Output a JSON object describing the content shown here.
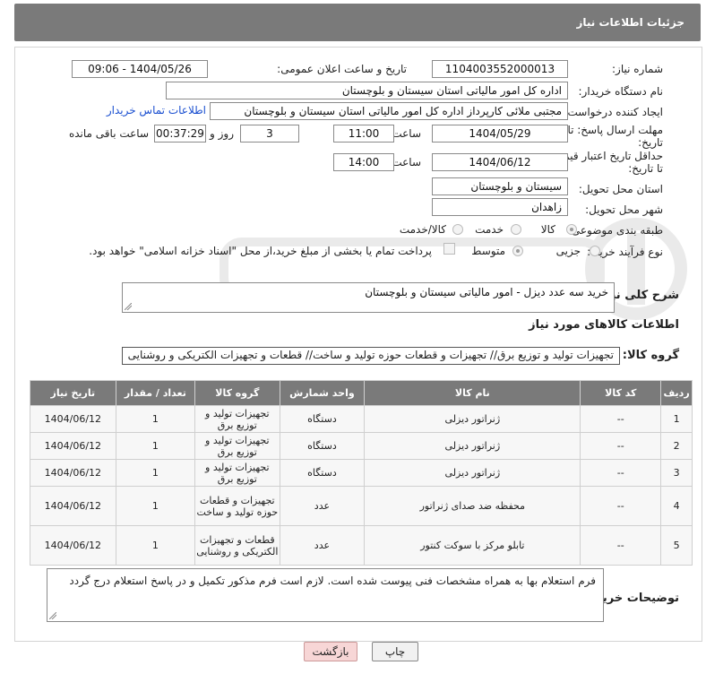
{
  "header": {
    "title": "جزئیات اطلاعات نیاز"
  },
  "form": {
    "need_number_label": "شماره نیاز:",
    "need_number": "1104003552000013",
    "announce_label": "تاریخ و ساعت اعلان عمومی:",
    "announce_value": "1404/05/26 - 09:06",
    "buyer_org_label": "نام دستگاه خریدار:",
    "buyer_org": "اداره کل امور مالیاتی استان سیستان و بلوچستان",
    "creator_label": "ایجاد کننده درخواست:",
    "creator": "مجتبی ملائی کارپرداز اداره کل امور مالیاتی استان سیستان و بلوچستان",
    "contact_link": "اطلاعات تماس خریدار",
    "deadline_label_1": "مهلت ارسال پاسخ: تا",
    "deadline_label_2": "تاریخ:",
    "deadline_date": "1404/05/29",
    "time_label": "ساعت",
    "deadline_time": "11:00",
    "days_value": "3",
    "days_label": "روز و",
    "remaining_value": "00:37:29",
    "remaining_label": "ساعت باقی مانده",
    "min_price_label_1": "حداقل تاریخ اعتبار قیمت:",
    "min_price_label_2": "تا تاریخ:",
    "min_price_date": "1404/06/12",
    "min_price_time": "14:00",
    "province_label": "استان محل تحویل:",
    "province": "سیستان و بلوچستان",
    "city_label": "شهر محل تحویل:",
    "city": "زاهدان",
    "category_label": "طبقه بندی موضوعی:",
    "category_options": [
      "کالا",
      "خدمت",
      "کالا/خدمت"
    ],
    "process_label": "نوع فرآیند خرید :",
    "process_options": [
      "جزیی",
      "متوسط"
    ],
    "payment_note": "پرداخت تمام یا بخشی از مبلغ خرید،از محل \"اسناد خزانه اسلامی\" خواهد بود."
  },
  "description": {
    "label": "شرح کلی نیاز:",
    "value": "خرید سه عدد دیزل - امور مالیاتی سیستان و بلوچستان"
  },
  "goods": {
    "section_title": "اطلاعات کالاهای مورد نیاز",
    "group_label": "گروه کالا:",
    "group_value": "تجهیزات تولید و توزیع برق// تجهیزات و قطعات حوزه تولید و ساخت// قطعات و تجهیزات الکتریکی و روشنایی",
    "columns": [
      "ردیف",
      "کد کالا",
      "نام کالا",
      "واحد شمارش",
      "گروه کالا",
      "تعداد / مقدار",
      "تاریخ نیاز"
    ],
    "rows": [
      {
        "idx": "1",
        "code": "--",
        "name": "ژنراتور دیزلی",
        "unit": "دستگاه",
        "group": "تجهیزات تولید و توزیع برق",
        "qty": "1",
        "date": "1404/06/12"
      },
      {
        "idx": "2",
        "code": "--",
        "name": "ژنراتور دیزلی",
        "unit": "دستگاه",
        "group": "تجهیزات تولید و توزیع برق",
        "qty": "1",
        "date": "1404/06/12"
      },
      {
        "idx": "3",
        "code": "--",
        "name": "ژنراتور دیزلی",
        "unit": "دستگاه",
        "group": "تجهیزات تولید و توزیع برق",
        "qty": "1",
        "date": "1404/06/12"
      },
      {
        "idx": "4",
        "code": "--",
        "name": "محفظه ضد صدای ژنراتور",
        "unit": "عدد",
        "group": "تجهیزات و قطعات حوزه تولید و ساخت",
        "qty": "1",
        "date": "1404/06/12"
      },
      {
        "idx": "5",
        "code": "--",
        "name": "تابلو مرکز با سوکت کنتور",
        "unit": "عدد",
        "group": "قطعات و تجهیزات الکتریکی و روشنایی",
        "qty": "1",
        "date": "1404/06/12"
      }
    ]
  },
  "buyer_notes": {
    "label": "توضیحات خریدار:",
    "value": "فرم استعلام بها به همراه مشخصات فنی پیوست شده است. لازم است فرم مذکور تکمیل و در پاسخ استعلام درج گردد"
  },
  "buttons": {
    "print": "چاپ",
    "back": "بازگشت"
  },
  "colors": {
    "header_bg": "#7a7a7a",
    "back_button_bg": "#f7d6d6",
    "print_button_bg": "#f1f1f1",
    "link": "#1a4fd0"
  }
}
